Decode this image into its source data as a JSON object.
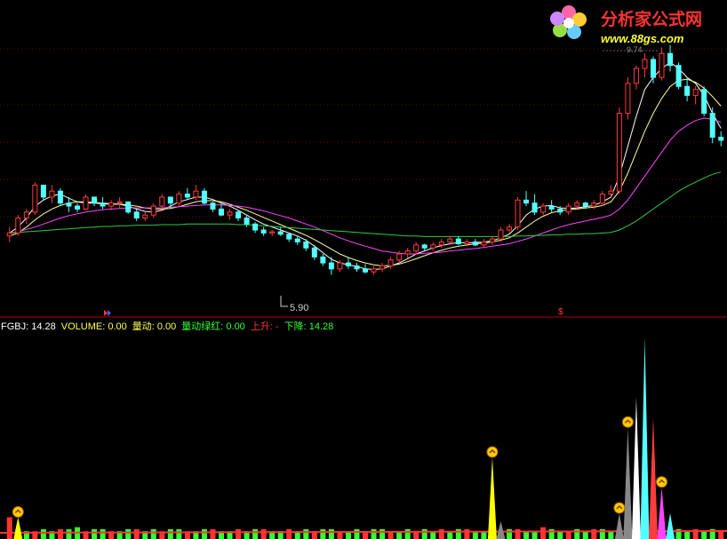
{
  "watermark": {
    "name": "分析家公式网",
    "url": "www.88gs.com",
    "logo": "flower-logo-icon"
  },
  "colors": {
    "background": "#000000",
    "up": "#ff3b3b",
    "down": "#54ffff",
    "grid": "#7a0000",
    "ma_short": "#ffffff",
    "ma_mid": "#ffff99",
    "ma_long": "#ff44ff",
    "ma_longest": "#2ecc40",
    "volume_text": "#ffff55",
    "green": "#33ff33",
    "red": "#ff3333"
  },
  "price_panel": {
    "low_label": "5.90",
    "top_label": "9.74",
    "signal_marker": "$"
  },
  "indicator_bar": {
    "items": [
      {
        "key": "FGBJ",
        "sep": ": ",
        "value": "14.28",
        "color": "#ffffff"
      },
      {
        "key": "VOLUME",
        "sep": ": ",
        "value": "0.00",
        "color": "#ffff55"
      },
      {
        "key": "量动",
        "sep": ": ",
        "value": "0.00",
        "color": "#ffff55"
      },
      {
        "key": "量动绿红",
        "sep": ": ",
        "value": "0.00",
        "color": "#33ff33"
      },
      {
        "key": "上升",
        "sep": ": ",
        "value": "-",
        "color": "#ff3333"
      },
      {
        "key": "下降",
        "sep": ": ",
        "value": "14.28",
        "color": "#33ff33"
      }
    ]
  },
  "chart_data": [
    {
      "type": "candlestick",
      "ylim": [
        5.3,
        9.9
      ],
      "annotations": [
        "5.90"
      ],
      "candles": [
        [
          6.55,
          6.7,
          6.45,
          6.6
        ],
        [
          6.6,
          6.9,
          6.55,
          6.85
        ],
        [
          6.85,
          7.0,
          6.75,
          6.95
        ],
        [
          6.95,
          7.45,
          6.9,
          7.4
        ],
        [
          7.4,
          7.35,
          7.15,
          7.2
        ],
        [
          7.2,
          7.4,
          7.1,
          7.3
        ],
        [
          7.3,
          7.35,
          7.05,
          7.1
        ],
        [
          7.1,
          7.2,
          6.95,
          7.05
        ],
        [
          7.05,
          7.1,
          6.95,
          7.0
        ],
        [
          7.0,
          7.25,
          6.98,
          7.2
        ],
        [
          7.2,
          7.18,
          7.05,
          7.1
        ],
        [
          7.1,
          7.2,
          7.0,
          7.05
        ],
        [
          7.05,
          7.15,
          6.98,
          7.1
        ],
        [
          7.1,
          7.2,
          7.02,
          7.12
        ],
        [
          7.12,
          7.1,
          6.92,
          6.95
        ],
        [
          6.95,
          7.0,
          6.8,
          6.85
        ],
        [
          6.85,
          6.95,
          6.8,
          6.9
        ],
        [
          6.9,
          7.1,
          6.85,
          7.05
        ],
        [
          7.05,
          7.25,
          7.0,
          7.2
        ],
        [
          7.2,
          7.18,
          7.02,
          7.1
        ],
        [
          7.1,
          7.3,
          7.05,
          7.25
        ],
        [
          7.25,
          7.35,
          7.15,
          7.2
        ],
        [
          7.2,
          7.4,
          7.15,
          7.3
        ],
        [
          7.3,
          7.35,
          7.08,
          7.1
        ],
        [
          7.1,
          7.12,
          6.95,
          7.0
        ],
        [
          7.0,
          7.1,
          6.88,
          6.9
        ],
        [
          6.9,
          7.0,
          6.82,
          6.95
        ],
        [
          6.95,
          6.98,
          6.8,
          6.85
        ],
        [
          6.85,
          6.9,
          6.7,
          6.75
        ],
        [
          6.75,
          6.78,
          6.6,
          6.65
        ],
        [
          6.65,
          6.7,
          6.55,
          6.6
        ],
        [
          6.6,
          6.65,
          6.55,
          6.62
        ],
        [
          6.62,
          6.7,
          6.55,
          6.58
        ],
        [
          6.58,
          6.6,
          6.45,
          6.5
        ],
        [
          6.5,
          6.55,
          6.4,
          6.45
        ],
        [
          6.45,
          6.5,
          6.3,
          6.35
        ],
        [
          6.35,
          6.4,
          6.15,
          6.2
        ],
        [
          6.2,
          6.25,
          6.05,
          6.1
        ],
        [
          6.1,
          6.2,
          5.9,
          6.0
        ],
        [
          6.0,
          6.15,
          5.95,
          6.1
        ],
        [
          6.1,
          6.2,
          6.0,
          6.05
        ],
        [
          6.05,
          6.1,
          5.95,
          6.0
        ],
        [
          6.0,
          6.08,
          5.92,
          5.95
        ],
        [
          5.95,
          6.05,
          5.9,
          6.0
        ],
        [
          6.0,
          6.1,
          5.95,
          6.05
        ],
        [
          6.05,
          6.2,
          6.0,
          6.15
        ],
        [
          6.15,
          6.3,
          6.1,
          6.25
        ],
        [
          6.25,
          6.35,
          6.18,
          6.3
        ],
        [
          6.3,
          6.45,
          6.25,
          6.4
        ],
        [
          6.4,
          6.42,
          6.3,
          6.35
        ],
        [
          6.35,
          6.45,
          6.3,
          6.4
        ],
        [
          6.4,
          6.5,
          6.35,
          6.45
        ],
        [
          6.45,
          6.55,
          6.4,
          6.5
        ],
        [
          6.5,
          6.55,
          6.4,
          6.42
        ],
        [
          6.42,
          6.5,
          6.38,
          6.45
        ],
        [
          6.45,
          6.5,
          6.38,
          6.4
        ],
        [
          6.4,
          6.5,
          6.35,
          6.45
        ],
        [
          6.45,
          6.55,
          6.4,
          6.5
        ],
        [
          6.5,
          6.7,
          6.45,
          6.65
        ],
        [
          6.65,
          6.75,
          6.6,
          6.7
        ],
        [
          6.7,
          7.2,
          6.65,
          7.15
        ],
        [
          7.15,
          7.3,
          7.05,
          7.1
        ],
        [
          7.1,
          7.25,
          6.9,
          6.95
        ],
        [
          6.95,
          7.1,
          6.9,
          7.05
        ],
        [
          7.05,
          7.15,
          6.95,
          7.0
        ],
        [
          7.0,
          7.05,
          6.9,
          6.95
        ],
        [
          6.95,
          7.1,
          6.9,
          7.05
        ],
        [
          7.05,
          7.15,
          7.0,
          7.1
        ],
        [
          7.1,
          7.12,
          7.0,
          7.05
        ],
        [
          7.05,
          7.15,
          7.0,
          7.1
        ],
        [
          7.1,
          7.3,
          7.05,
          7.25
        ],
        [
          7.25,
          7.4,
          7.2,
          7.3
        ],
        [
          7.3,
          8.7,
          7.25,
          8.6
        ],
        [
          8.6,
          9.2,
          8.5,
          9.1
        ],
        [
          9.1,
          9.4,
          9.0,
          9.35
        ],
        [
          9.35,
          9.6,
          9.2,
          9.5
        ],
        [
          9.5,
          9.55,
          9.1,
          9.2
        ],
        [
          9.2,
          9.7,
          9.15,
          9.6
        ],
        [
          9.6,
          9.74,
          9.3,
          9.4
        ],
        [
          9.4,
          9.45,
          9.0,
          9.05
        ],
        [
          9.05,
          9.2,
          8.8,
          8.9
        ],
        [
          8.9,
          9.05,
          8.75,
          9.0
        ],
        [
          9.0,
          9.05,
          8.55,
          8.6
        ],
        [
          8.6,
          8.7,
          8.1,
          8.2
        ],
        [
          8.2,
          8.3,
          8.05,
          8.15
        ]
      ],
      "ma_series": [
        {
          "values": [
            6.6,
            6.7,
            6.85,
            7.05,
            7.15,
            7.22,
            7.25,
            7.18,
            7.12,
            7.1,
            7.1,
            7.09,
            7.08,
            7.08,
            7.05,
            7.0,
            6.96,
            6.95,
            6.98,
            7.05,
            7.12,
            7.16,
            7.2,
            7.2,
            7.16,
            7.1,
            7.05,
            6.98,
            6.9,
            6.82,
            6.75,
            6.7,
            6.65,
            6.6,
            6.55,
            6.48,
            6.38,
            6.27,
            6.16,
            6.1,
            6.07,
            6.04,
            6.0,
            5.99,
            6.0,
            6.05,
            6.1,
            6.17,
            6.25,
            6.3,
            6.35,
            6.39,
            6.42,
            6.44,
            6.44,
            6.44,
            6.45,
            6.47,
            6.52,
            6.58,
            6.72,
            6.9,
            7.0,
            7.05,
            7.06,
            7.02,
            7.01,
            7.02,
            7.04,
            7.06,
            7.12,
            7.2,
            7.55,
            8.05,
            8.55,
            9.0,
            9.2,
            9.35,
            9.45,
            9.35,
            9.2,
            9.1,
            8.9,
            8.6,
            8.35
          ]
        },
        {
          "values": [
            6.55,
            6.6,
            6.7,
            6.82,
            6.92,
            7.0,
            7.06,
            7.1,
            7.12,
            7.12,
            7.11,
            7.1,
            7.09,
            7.08,
            7.07,
            7.05,
            7.02,
            7.0,
            7.0,
            7.01,
            7.04,
            7.08,
            7.12,
            7.14,
            7.14,
            7.12,
            7.08,
            7.03,
            6.98,
            6.92,
            6.86,
            6.8,
            6.74,
            6.68,
            6.62,
            6.56,
            6.49,
            6.41,
            6.33,
            6.25,
            6.19,
            6.14,
            6.1,
            6.07,
            6.05,
            6.06,
            6.08,
            6.12,
            6.17,
            6.22,
            6.27,
            6.31,
            6.35,
            6.38,
            6.4,
            6.42,
            6.43,
            6.45,
            6.48,
            6.52,
            6.6,
            6.7,
            6.8,
            6.88,
            6.94,
            6.97,
            6.99,
            7.0,
            7.02,
            7.03,
            7.06,
            7.12,
            7.3,
            7.6,
            7.95,
            8.3,
            8.6,
            8.85,
            9.05,
            9.15,
            9.17,
            9.12,
            9.02,
            8.88,
            8.72
          ]
        },
        {
          "values": [
            6.6,
            6.62,
            6.66,
            6.7,
            6.75,
            6.8,
            6.85,
            6.89,
            6.92,
            6.95,
            6.97,
            6.99,
            7.0,
            7.01,
            7.02,
            7.02,
            7.02,
            7.02,
            7.02,
            7.03,
            7.04,
            7.05,
            7.06,
            7.07,
            7.07,
            7.07,
            7.06,
            7.05,
            7.03,
            7.0,
            6.97,
            6.93,
            6.89,
            6.85,
            6.8,
            6.75,
            6.7,
            6.64,
            6.58,
            6.52,
            6.47,
            6.42,
            6.38,
            6.34,
            6.3,
            6.28,
            6.26,
            6.25,
            6.25,
            6.26,
            6.27,
            6.28,
            6.3,
            6.31,
            6.33,
            6.34,
            6.36,
            6.38,
            6.4,
            6.42,
            6.46,
            6.5,
            6.55,
            6.6,
            6.65,
            6.7,
            6.74,
            6.77,
            6.8,
            6.83,
            6.86,
            6.9,
            7.0,
            7.15,
            7.35,
            7.55,
            7.75,
            7.95,
            8.15,
            8.3,
            8.4,
            8.48,
            8.52,
            8.5,
            8.45
          ]
        },
        {
          "values": [
            6.6,
            6.61,
            6.62,
            6.63,
            6.64,
            6.65,
            6.66,
            6.67,
            6.68,
            6.69,
            6.7,
            6.71,
            6.71,
            6.72,
            6.72,
            6.73,
            6.73,
            6.73,
            6.74,
            6.74,
            6.74,
            6.75,
            6.75,
            6.75,
            6.75,
            6.75,
            6.75,
            6.74,
            6.74,
            6.73,
            6.72,
            6.71,
            6.7,
            6.69,
            6.68,
            6.67,
            6.66,
            6.65,
            6.64,
            6.63,
            6.62,
            6.61,
            6.6,
            6.59,
            6.58,
            6.57,
            6.56,
            6.55,
            6.55,
            6.54,
            6.54,
            6.54,
            6.54,
            6.54,
            6.54,
            6.54,
            6.54,
            6.54,
            6.54,
            6.54,
            6.55,
            6.55,
            6.56,
            6.56,
            6.57,
            6.57,
            6.58,
            6.58,
            6.59,
            6.59,
            6.6,
            6.61,
            6.65,
            6.72,
            6.8,
            6.9,
            7.0,
            7.1,
            7.2,
            7.3,
            7.38,
            7.45,
            7.52,
            7.58,
            7.62
          ]
        }
      ]
    },
    {
      "type": "bar",
      "ylim": [
        0,
        100
      ],
      "values": [
        10,
        4,
        3,
        3,
        4,
        3,
        4,
        4,
        5,
        3,
        4,
        4,
        3,
        3,
        4,
        4,
        3,
        4,
        3,
        4,
        4,
        3,
        3,
        4,
        4,
        3,
        3,
        4,
        3,
        4,
        4,
        3,
        3,
        4,
        3,
        4,
        3,
        4,
        4,
        3,
        3,
        4,
        3,
        4,
        4,
        3,
        3,
        4,
        3,
        4,
        3,
        4,
        3,
        4,
        4,
        3,
        3,
        4,
        3,
        4,
        4,
        3,
        3,
        5,
        4,
        3,
        3,
        4,
        3,
        4,
        4,
        3,
        3,
        4,
        3,
        4,
        4,
        3,
        3,
        4,
        3,
        4,
        3,
        4,
        3
      ],
      "spikes": [
        {
          "index": 1,
          "value": 10,
          "color": "#ffff00",
          "marker": true
        },
        {
          "index": 57,
          "value": 40,
          "color": "#ffff00",
          "marker": true
        },
        {
          "index": 58,
          "value": 8,
          "color": "#888888",
          "marker": false
        },
        {
          "index": 72,
          "value": 12,
          "color": "#888888",
          "marker": true
        },
        {
          "index": 73,
          "value": 55,
          "color": "#888888",
          "marker": true
        },
        {
          "index": 74,
          "value": 70,
          "color": "#ffffff",
          "marker": false
        },
        {
          "index": 75,
          "value": 100,
          "color": "#54ffff",
          "marker": false
        },
        {
          "index": 76,
          "value": 60,
          "color": "#ff3b3b",
          "marker": false
        },
        {
          "index": 77,
          "value": 25,
          "color": "#ff44ff",
          "marker": true
        },
        {
          "index": 78,
          "value": 12,
          "color": "#54ffff",
          "marker": false
        }
      ]
    }
  ]
}
